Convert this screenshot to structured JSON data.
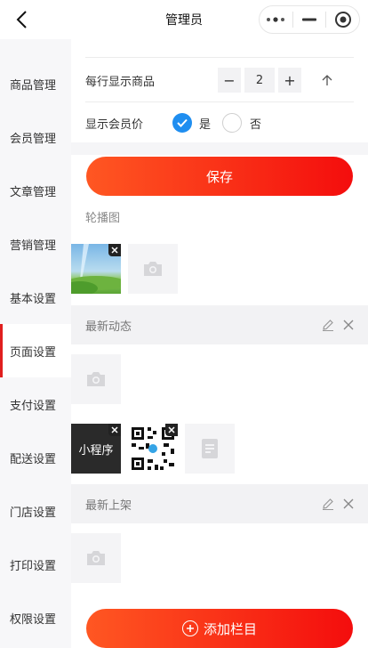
{
  "navbar": {
    "title": "管理员",
    "back_icon": "chevron-left-icon",
    "capsule": [
      "more-dots-icon",
      "minimize-icon",
      "record-target-icon"
    ]
  },
  "sidebar": {
    "items": [
      {
        "label": "商品管理"
      },
      {
        "label": "会员管理"
      },
      {
        "label": "文章管理"
      },
      {
        "label": "营销管理"
      },
      {
        "label": "基本设置"
      },
      {
        "label": "页面设置",
        "active": true
      },
      {
        "label": "支付设置"
      },
      {
        "label": "配送设置"
      },
      {
        "label": "门店设置"
      },
      {
        "label": "打印设置"
      },
      {
        "label": "权限设置"
      }
    ],
    "accent": "#e01e1e"
  },
  "settings": {
    "per_row_label": "每行显示商品",
    "per_row_value": "2",
    "minus": "−",
    "plus": "+",
    "member_price_label": "显示会员价",
    "yes_label": "是",
    "no_label": "否",
    "yes_selected": true
  },
  "save_button": "保存",
  "carousel": {
    "title": "轮播图"
  },
  "section_latest_news": {
    "title": "最新动态"
  },
  "miniprogram_thumb": "小程序",
  "section_new_arrivals": {
    "title": "最新上架"
  },
  "add_column_button": "添加栏目",
  "colors": {
    "primary_red": "#f40d0d",
    "orange": "#ff5722",
    "blue_check": "#1f8ef0"
  }
}
